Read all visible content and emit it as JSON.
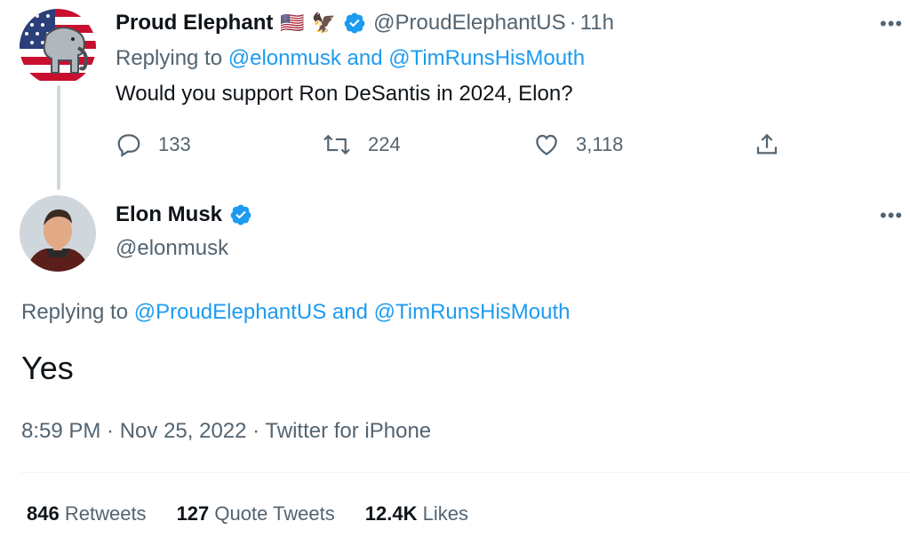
{
  "reply_tweet": {
    "author_name": "Proud Elephant",
    "flag_emoji": "🇺🇸",
    "eagle_emoji": "🦅",
    "handle": "@ProudElephantUS",
    "separator": "·",
    "time_ago": "11h",
    "replying_prefix": "Replying to ",
    "replying_user1": "@elonmusk",
    "replying_and": " and ",
    "replying_user2": "@TimRunsHisMouth",
    "text": "Would you support Ron DeSantis in 2024, Elon?",
    "more": "•••",
    "actions": {
      "replies": "133",
      "retweets": "224",
      "likes": "3,118"
    }
  },
  "main_tweet": {
    "author_name": "Elon Musk",
    "handle": "@elonmusk",
    "more": "•••",
    "replying_prefix": "Replying to ",
    "replying_user1": "@ProudElephantUS",
    "replying_and": " and ",
    "replying_user2": "@TimRunsHisMouth",
    "text": "Yes",
    "time": "8:59 PM",
    "dot1": " · ",
    "date": "Nov 25, 2022",
    "dot2": " · ",
    "source": "Twitter for iPhone",
    "stats": {
      "retweets_count": "846",
      "retweets_label": "Retweets",
      "quotes_count": "127",
      "quotes_label": "Quote Tweets",
      "likes_count": "12.4K",
      "likes_label": "Likes"
    }
  },
  "colors": {
    "accent": "#1d9bf0",
    "muted": "#536471",
    "text": "#0f1419"
  }
}
